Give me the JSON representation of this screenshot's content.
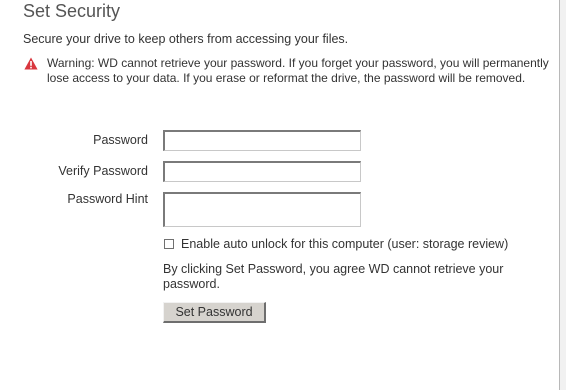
{
  "page": {
    "title": "Set Security",
    "subtitle": "Secure your drive to keep others from accessing your files."
  },
  "warning": {
    "icon": "warning-triangle-icon",
    "icon_color": "#d9363e",
    "text": "Warning: WD cannot retrieve your password. If you forget your password, you will permanently lose access to your data. If you erase or reformat the drive, the password will be removed."
  },
  "form": {
    "password_label": "Password",
    "password_value": "",
    "verify_label": "Verify Password",
    "verify_value": "",
    "hint_label": "Password Hint",
    "hint_value": "",
    "auto_unlock_checked": false,
    "auto_unlock_label": "Enable auto unlock for this computer (user: storage review)",
    "agreement_text": "By clicking Set Password, you agree WD cannot retrieve your password.",
    "submit_label": "Set Password"
  }
}
